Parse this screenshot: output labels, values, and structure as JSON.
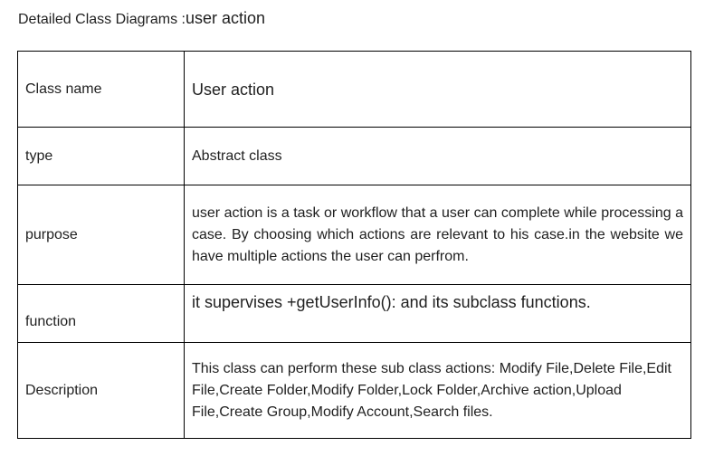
{
  "title": {
    "prefix": "Detailed Class Diagrams :",
    "suffix": "user action"
  },
  "rows": [
    {
      "key": "Class name",
      "value": "User action"
    },
    {
      "key": "type",
      "value": "Abstract class"
    },
    {
      "key": "purpose",
      "value": "user action is a task or workflow that a user can complete while processing a case. By choosing which actions are relevant to his case.in the website we have multiple actions the user can perfrom."
    },
    {
      "key": "function",
      "value": "it supervises +getUserInfo(): and its subclass functions."
    },
    {
      "key": "Description",
      "value": "This class can perform these sub class actions: Modify File,Delete File,Edit File,Create Folder,Modify Folder,Lock Folder,Archive action,Upload File,Create Group,Modify Account,Search files."
    }
  ]
}
